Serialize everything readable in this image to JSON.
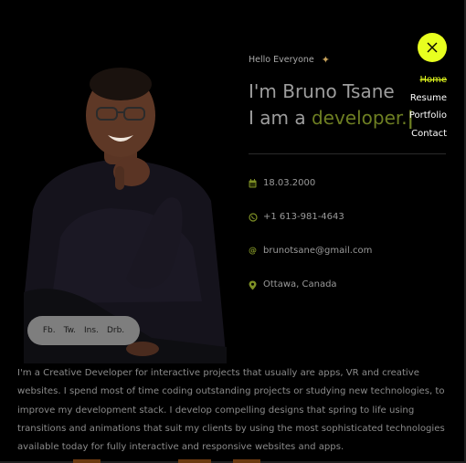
{
  "header": {
    "greeting": "Hello Everyone",
    "wave_icon": "waving-hand-icon",
    "name": "I'm Bruno Tsane",
    "role_prefix": "I am a ",
    "role_accent": "developer.",
    "cursor": "|"
  },
  "info": {
    "birthdate": "18.03.2000",
    "phone": "+1 613-981-4643",
    "email": "brunotsane@gmail.com",
    "location": "Ottawa, Canada",
    "icons": [
      "calendar-icon",
      "whatsapp-icon",
      "at-icon",
      "location-pin-icon"
    ]
  },
  "social": {
    "items": [
      "Fb.",
      "Tw.",
      "Ins.",
      "Drb."
    ]
  },
  "nav": {
    "close_icon": "close-icon",
    "items": [
      "Home",
      "Resume",
      "Portfolio",
      "Contact"
    ],
    "active": "Home"
  },
  "bio": {
    "text": "I'm a Creative Developer for interactive projects that usually are apps, VR and creative websites. I spend most of time coding outstanding projects or studying new technologies, to improve my development stack. I develop compelling designs that spring to life using transitions and animations that suit my clients by using the most sophisticated technologies available today for fully interactive and responsive websites and apps."
  },
  "colors": {
    "accent": "#e8ff1f",
    "accent_dark": "#6e7f22",
    "background": "#000000"
  }
}
